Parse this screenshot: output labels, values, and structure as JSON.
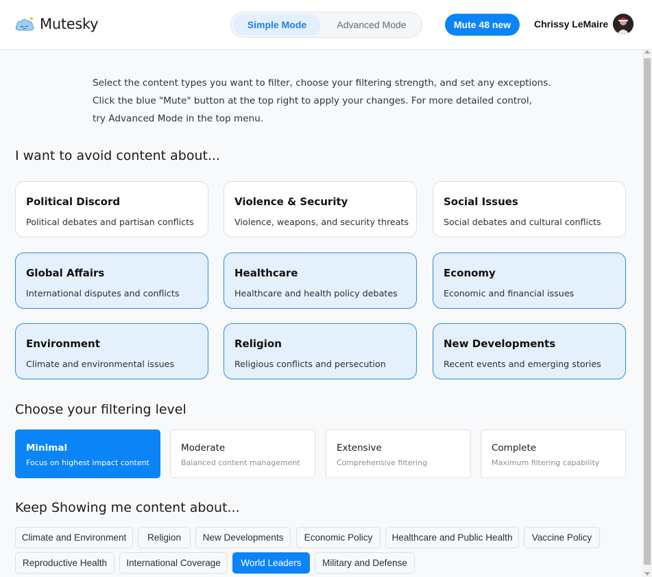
{
  "app": {
    "name": "Mutesky",
    "logo_icon": "sleeping-cloud-icon"
  },
  "header": {
    "modes": [
      {
        "label": "Simple Mode",
        "active": true
      },
      {
        "label": "Advanced Mode",
        "active": false
      }
    ],
    "mute_button_label": "Mute 48 new",
    "user_name": "Chrissy LeMaire",
    "avatar_icon": "user-avatar"
  },
  "intro": {
    "line1": "Select the content types you want to filter, choose your filtering strength, and set any exceptions.",
    "line2": "Click the blue \"Mute\" button at the top right to apply your changes. For more detailed control,",
    "line3": "try Advanced Mode in the top menu."
  },
  "avoid_section": {
    "title": "I want to avoid content about...",
    "topics": [
      {
        "title": "Political Discord",
        "description": "Political debates and partisan conflicts",
        "selected": false
      },
      {
        "title": "Violence & Security",
        "description": "Violence, weapons, and security threats",
        "selected": false
      },
      {
        "title": "Social Issues",
        "description": "Social debates and cultural conflicts",
        "selected": false
      },
      {
        "title": "Global Affairs",
        "description": "International disputes and conflicts",
        "selected": true
      },
      {
        "title": "Healthcare",
        "description": "Healthcare and health policy debates",
        "selected": true
      },
      {
        "title": "Economy",
        "description": "Economic and financial issues",
        "selected": true
      },
      {
        "title": "Environment",
        "description": "Climate and environmental issues",
        "selected": true
      },
      {
        "title": "Religion",
        "description": "Religious conflicts and persecution",
        "selected": true
      },
      {
        "title": "New Developments",
        "description": "Recent events and emerging stories",
        "selected": true
      }
    ]
  },
  "filter_section": {
    "title": "Choose your filtering level",
    "levels": [
      {
        "name": "Minimal",
        "description": "Focus on highest impact content",
        "selected": true
      },
      {
        "name": "Moderate",
        "description": "Balanced content management",
        "selected": false
      },
      {
        "name": "Extensive",
        "description": "Comprehensive filtering",
        "selected": false
      },
      {
        "name": "Complete",
        "description": "Maximum filtering capability",
        "selected": false
      }
    ]
  },
  "keep_section": {
    "title": "Keep Showing me content about...",
    "chips": [
      {
        "label": "Climate and Environment",
        "selected": false
      },
      {
        "label": "Religion",
        "selected": false
      },
      {
        "label": "New Developments",
        "selected": false
      },
      {
        "label": "Economic Policy",
        "selected": false
      },
      {
        "label": "Healthcare and Public Health",
        "selected": false
      },
      {
        "label": "Vaccine Policy",
        "selected": false
      },
      {
        "label": "Reproductive Health",
        "selected": false
      },
      {
        "label": "International Coverage",
        "selected": false
      },
      {
        "label": "World Leaders",
        "selected": true
      },
      {
        "label": "Military and Defense",
        "selected": false
      }
    ]
  },
  "colors": {
    "accent": "#0b84f7",
    "selected_card_bg": "#e4f0fc",
    "selected_card_border": "#2b8ae8"
  }
}
